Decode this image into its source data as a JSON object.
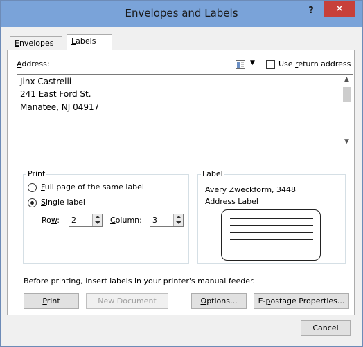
{
  "window": {
    "title": "Envelopes and Labels",
    "help_label": "?",
    "close_label": "✕"
  },
  "tabs": [
    {
      "label": "Envelopes",
      "accel": "E",
      "rest": "nvelopes",
      "active": false
    },
    {
      "label": "Labels",
      "accel": "L",
      "rest": "abels",
      "active": true
    }
  ],
  "address": {
    "label_accel": "A",
    "label_rest": "ddress:",
    "lines": [
      "Jinx Castrelli",
      "241 East Ford St.",
      "Manatee, NJ 04917"
    ],
    "use_return_address": {
      "checked": false,
      "pre": "Use ",
      "accel": "r",
      "post": "eturn address"
    },
    "address_book_icon": "address-book-icon"
  },
  "print": {
    "title": "Print",
    "options": [
      {
        "accel": "F",
        "rest": "ull page of the same label",
        "selected": false
      },
      {
        "accel": "S",
        "rest": "ingle label",
        "selected": true
      }
    ],
    "row": {
      "pre": "Ro",
      "accel": "w",
      "post": ":",
      "value": "2"
    },
    "column": {
      "accel": "C",
      "rest": "olumn:",
      "value": "3"
    }
  },
  "label": {
    "title": "Label",
    "vendor": "Avery Zweckform, 3448",
    "product": "Address Label"
  },
  "notice": "Before printing, insert labels in your printer's manual feeder.",
  "buttons": {
    "print": {
      "accel": "P",
      "rest": "rint"
    },
    "new_document": {
      "label": "New Document",
      "enabled": false
    },
    "options": {
      "accel": "O",
      "rest": "ptions..."
    },
    "epostage": {
      "pre": "E-",
      "accel": "p",
      "post": "ostage Properties..."
    },
    "cancel": "Cancel"
  },
  "colors": {
    "titlebar": "#7aa3d9",
    "close_button": "#c7403a",
    "dialog_bg": "#f0f0f0"
  }
}
